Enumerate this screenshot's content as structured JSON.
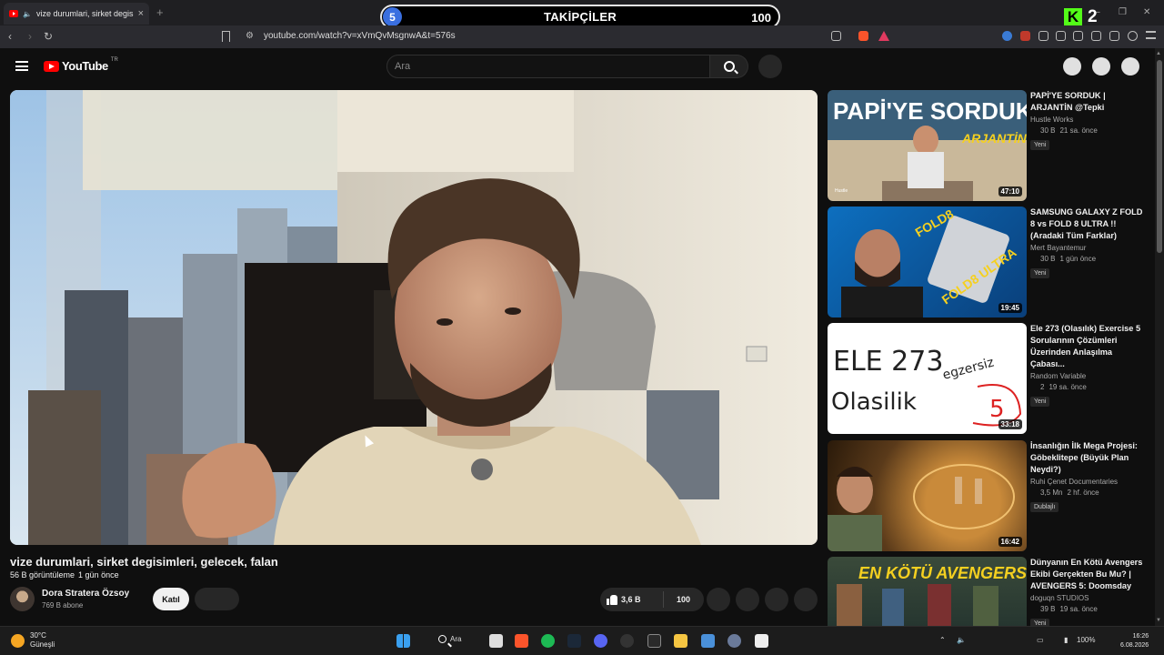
{
  "browser": {
    "tab_title": "vize durumlari, sirket degisim",
    "new_tab": "+",
    "url": "youtube.com/watch?v=xVmQvMsgnwA&t=576s",
    "nav": {
      "back": "‹",
      "forward": "›",
      "reload": "↻"
    },
    "window_controls": {
      "minimize": "–",
      "restore": "❐",
      "close": "✕"
    }
  },
  "follow_overlay": {
    "left_number": "5",
    "label": "TAKİPÇİLER",
    "right_number": "100"
  },
  "kick_overlay": {
    "letter": "K",
    "number": "2"
  },
  "youtube": {
    "logo_text": "YouTube",
    "region": "TR",
    "search_placeholder": "Ara"
  },
  "video": {
    "title": "vize durumlari, sirket degisimleri, gelecek, falan",
    "views": "56 B görüntüleme",
    "age": "1 gün önce",
    "channel": "Dora Stratera Özsoy",
    "subscribers": "769 B abone",
    "join_label": "Katıl",
    "likes": "3,6 B",
    "dislikes": "100"
  },
  "recommendations": [
    {
      "title": "PAPİ'YE SORDUK | ARJANTİN @Tepki",
      "channel": "Hustle Works",
      "views": "30 B",
      "age": "21 sa. önce",
      "badge": "Yeni",
      "duration": "47:10",
      "thumb_text": "PAPİ'YE SORDUK",
      "thumb_sub": "ARJANTİN",
      "thumb_corner": "Hustle"
    },
    {
      "title": "SAMSUNG GALAXY Z FOLD 8 vs FOLD 8 ULTRA !! (Aradaki Tüm Farklar)",
      "channel": "Mert Bayantemur",
      "views": "30 B",
      "age": "1 gün önce",
      "badge": "Yeni",
      "duration": "19:45",
      "thumb_text": "FOLD8",
      "thumb_sub": "FOLD8 ULTRA"
    },
    {
      "title": "Ele 273 (Olasılık) Exercise 5 Sorularının Çözümleri Üzerinden Anlaşılma Çabası...",
      "channel": "Random Variable",
      "views": "2",
      "age": "19 sa. önce",
      "badge": "Yeni",
      "duration": "33:18",
      "thumb_text": "ELE 273",
      "thumb_sub": "Olasilik",
      "thumb_note": "egzersiz",
      "thumb_digit": "5"
    },
    {
      "title": "İnsanlığın İlk Mega Projesi: Göbeklitepe (Büyük Plan Neydi?)",
      "channel": "Ruhi Çenet Documentaries",
      "views": "3,5 Mn",
      "age": "2 hf. önce",
      "badge": "Dublajlı",
      "duration": "16:42"
    },
    {
      "title": "Dünyanın En Kötü Avengers Ekibi Gerçekten Bu Mu? | AVENGERS 5: Doomsday",
      "channel": "doguqn STUDIOS",
      "views": "39 B",
      "age": "19 sa. önce",
      "badge": "Yeni",
      "thumb_text": "EN KÖTÜ AVENGERS"
    }
  ],
  "taskbar": {
    "temperature": "30°C",
    "weather": "Güneşli",
    "search": "Ara",
    "battery": "100%",
    "time": "16:26",
    "date": "6.08.2026"
  },
  "colors": {
    "accent": "#ff0000",
    "background": "#0f0f0f",
    "follow_badge": "#3a6fe0",
    "kick": "#53fc18"
  }
}
